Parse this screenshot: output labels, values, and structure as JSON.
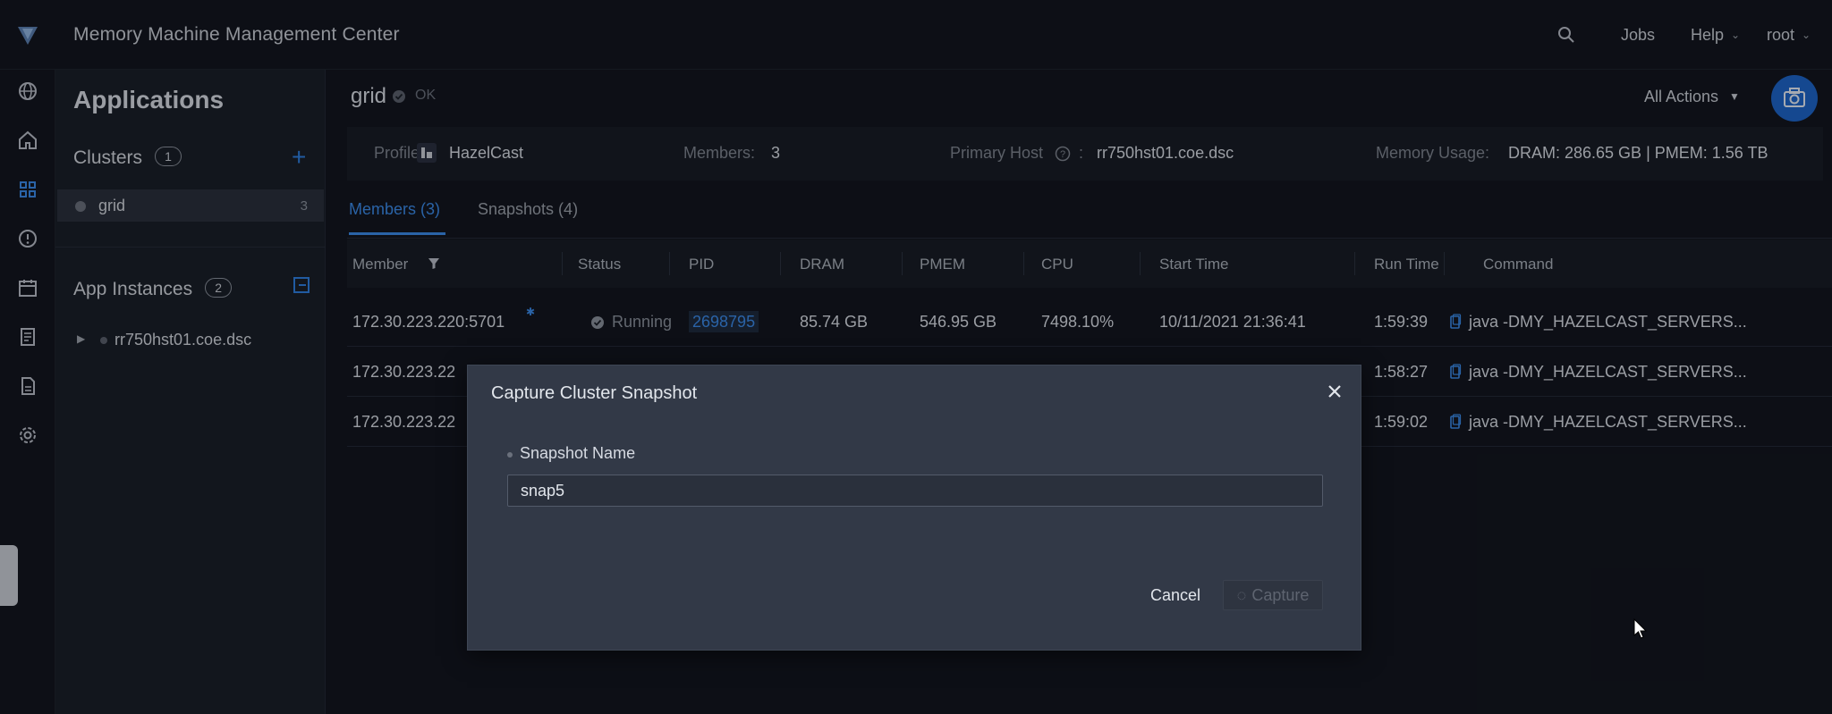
{
  "app": {
    "title": "Memory Machine Management Center",
    "accent_color": "#3b8ae8"
  },
  "topbar": {
    "search_icon": "search-icon",
    "jobs_label": "Jobs",
    "help_label": "Help",
    "user_label": "root"
  },
  "rail": {
    "icons": [
      "globe-icon",
      "home-icon",
      "apps-grid-icon",
      "alert-icon",
      "calendar-icon",
      "report-icon",
      "document-icon",
      "settings-icon"
    ]
  },
  "sidebar": {
    "title": "Applications",
    "clusters_label": "Clusters",
    "clusters_count": "1",
    "clusters": [
      {
        "name": "grid",
        "count": "3"
      }
    ],
    "instances_label": "App Instances",
    "instances_count": "2",
    "instances": [
      {
        "name": "rr750hst01.coe.dsc"
      }
    ]
  },
  "header": {
    "cluster_name": "grid",
    "status": "OK",
    "all_actions_label": "All Actions"
  },
  "info": {
    "profile_label": "Profile:",
    "profile_value": "HazelCast",
    "members_label": "Members:",
    "members_value": "3",
    "primary_host_label": "Primary Host",
    "primary_host_value": "rr750hst01.coe.dsc",
    "memory_label": "Memory Usage:",
    "memory_value": "DRAM: 286.65 GB | PMEM: 1.56 TB"
  },
  "tabs": [
    {
      "label": "Members (3)",
      "active": true
    },
    {
      "label": "Snapshots (4)",
      "active": false
    }
  ],
  "table": {
    "columns": [
      "Member",
      "Status",
      "PID",
      "DRAM",
      "PMEM",
      "CPU",
      "Start Time",
      "Run Time",
      "Command"
    ],
    "rows": [
      {
        "member": "172.30.223.220:5701",
        "status": "Running",
        "pid": "2698795",
        "dram": "85.74 GB",
        "pmem": "546.95 GB",
        "cpu": "7498.10%",
        "start": "10/11/2021 21:36:41",
        "run": "1:59:39",
        "command": "java -DMY_HAZELCAST_SERVERS..."
      },
      {
        "member": "172.30.223.22",
        "run": "1:58:27",
        "command": "java -DMY_HAZELCAST_SERVERS..."
      },
      {
        "member": "172.30.223.22",
        "run": "1:59:02",
        "command": "java -DMY_HAZELCAST_SERVERS..."
      }
    ]
  },
  "modal": {
    "title": "Capture Cluster Snapshot",
    "field_label": "Snapshot Name",
    "field_value": "snap5",
    "cancel_label": "Cancel",
    "capture_label": "Capture"
  }
}
